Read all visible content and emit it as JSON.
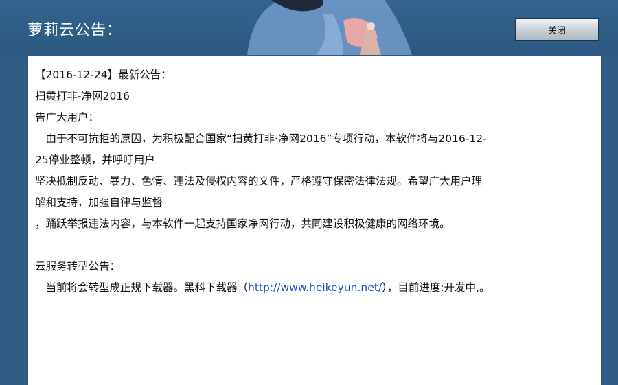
{
  "window": {
    "title": "萝莉云公告："
  },
  "close_button": {
    "label": "关闭"
  },
  "announcement": {
    "line1": "【2016-12-24】最新公告：",
    "line2": "扫黄打非-净网2016",
    "line3": "告广大用户：",
    "line4": "　由于不可抗拒的原因，为积极配合国家“扫黄打非·净网2016”专项行动，本软件将与2016-12-",
    "line5": "25停业整顿，并呼吁用户",
    "line6": "坚决抵制反动、暴力、色情、违法及侵权内容的文件，严格遵守保密法律法规。希望广大用户理",
    "line7": "解和支持，加强自律与监督",
    "line8": "，踊跃举报违法内容，与本软件一起支持国家净网行动，共同建设积极健康的网络环境。",
    "line9": "云服务转型公告：",
    "line10_before": "　当前将会转型成正规下载器。黑科下载器（",
    "link_text": "http://www.heikeyun.net/",
    "line10_after": "），目前进度:开发中,。"
  },
  "colors": {
    "background": "#2e5a84",
    "button_top": "#f4f6f8",
    "link": "#1a4fcc"
  }
}
